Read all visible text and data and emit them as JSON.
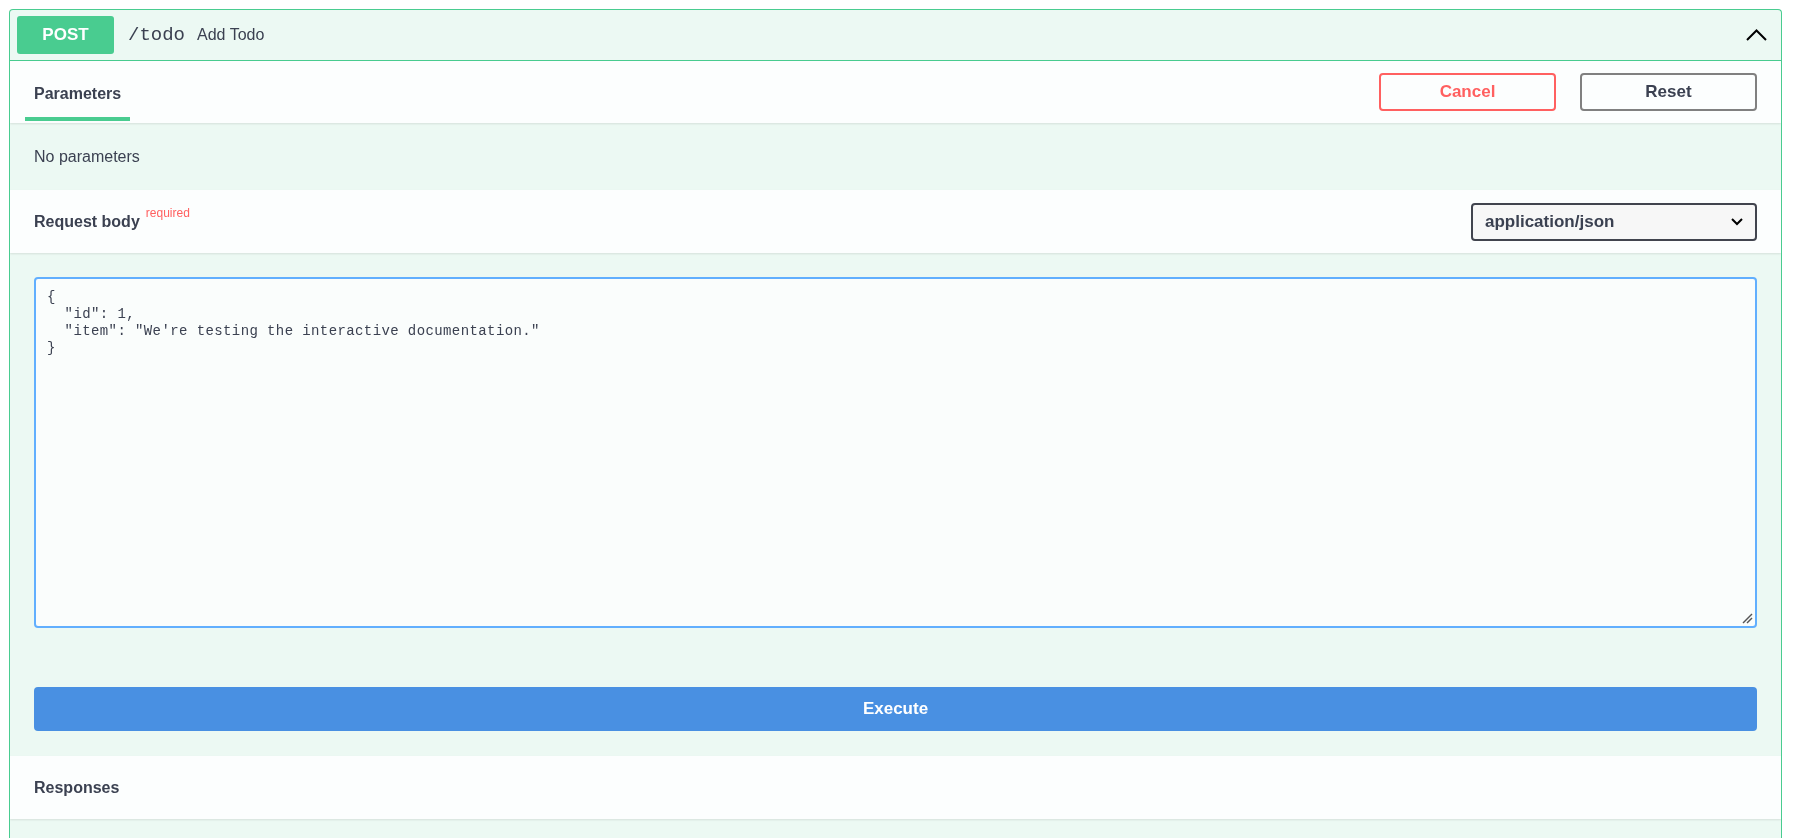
{
  "operation": {
    "method": "POST",
    "path": "/todo",
    "summary": "Add Todo",
    "expanded": true
  },
  "tabs": [
    {
      "label": "Parameters",
      "selected": true
    }
  ],
  "buttons": [
    {
      "label": "Cancel",
      "kind": "cancel"
    },
    {
      "label": "Reset",
      "kind": "reset"
    }
  ],
  "parameters": {
    "empty_text": "No parameters"
  },
  "request_body": {
    "title": "Request body",
    "required_label": "required",
    "content_type": "application/json",
    "editor": {
      "value": "{\n  \"id\": 1,\n  \"item\": \"We're testing the interactive documentation.\"\n}",
      "focused": true
    }
  },
  "execute": {
    "label": "Execute"
  },
  "responses": {
    "title": "Responses"
  }
}
